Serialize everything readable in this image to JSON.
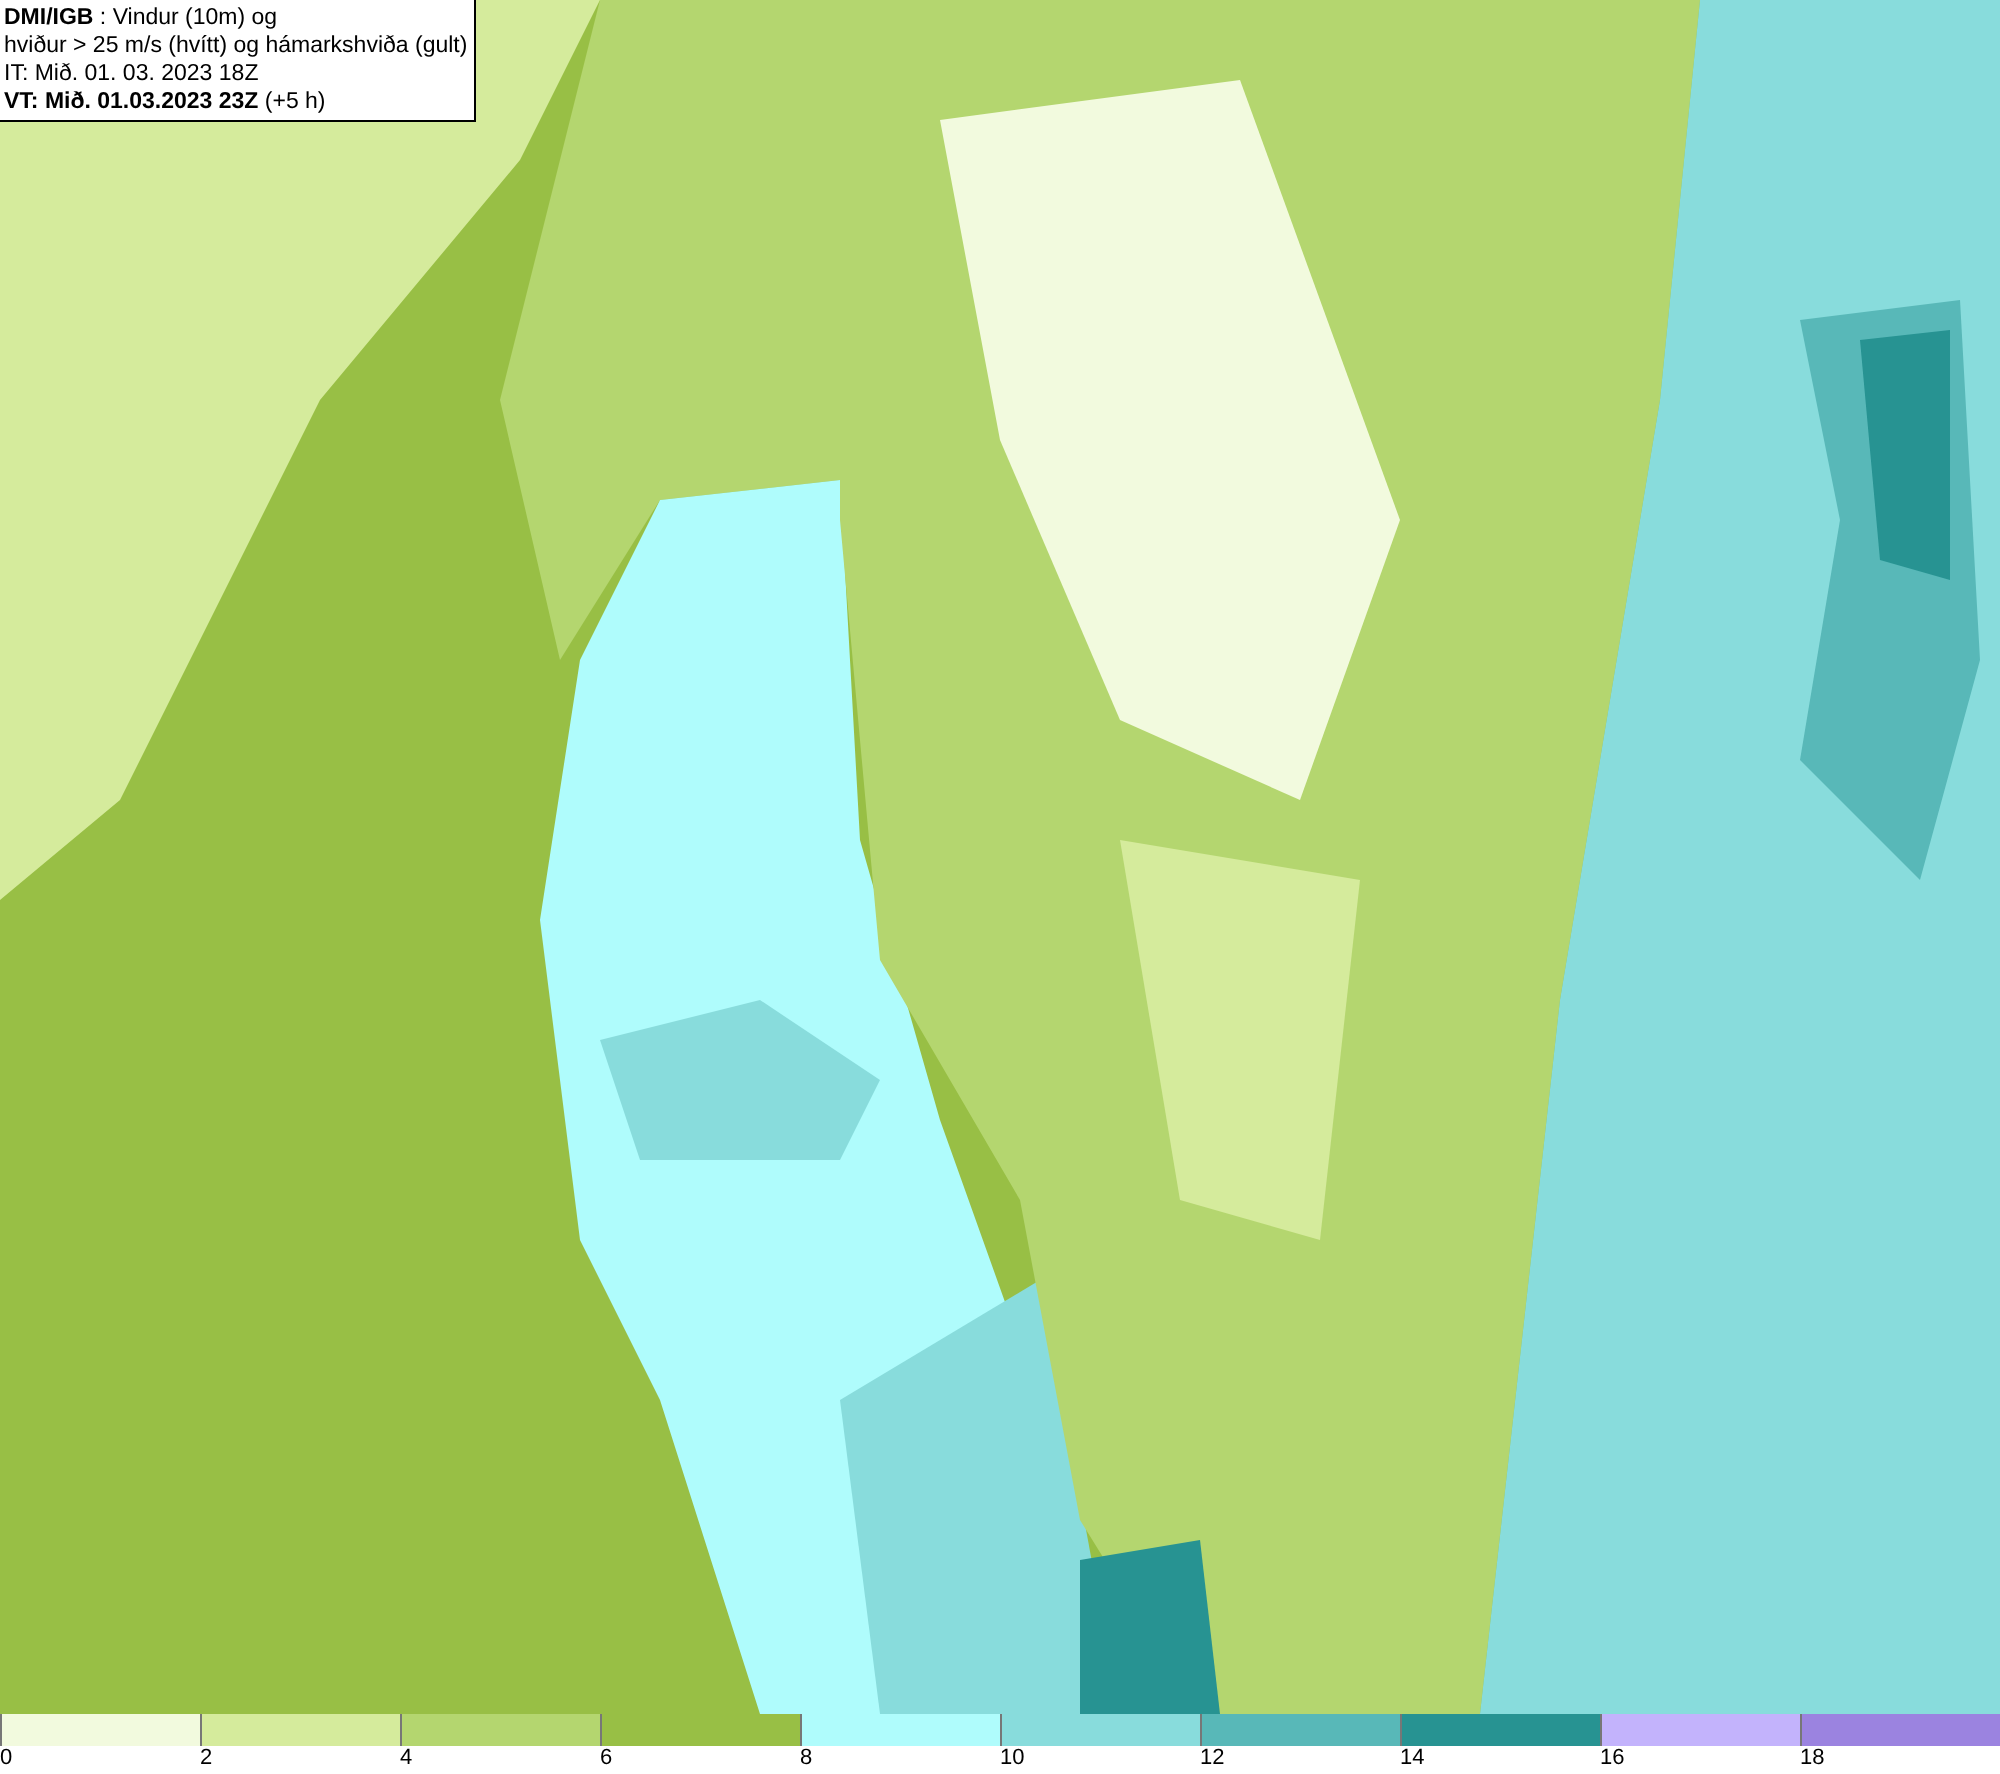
{
  "info_box": {
    "lines": [
      "**DMI/IGB** : Vindur (10m) og",
      "hviður > 25 m/s (hvítt) og hámarkshviða (gult)",
      "IT: Mið. 01. 03. 2023 18Z",
      "**VT: Mið. 01.03.2023 23Z** (+5 h)"
    ]
  },
  "legend": [
    {
      "label": "0",
      "color": "#f2fade"
    },
    {
      "label": "2",
      "color": "#d5eb9c"
    },
    {
      "label": "4",
      "color": "#b4d66f"
    },
    {
      "label": "6",
      "color": "#98bf45"
    },
    {
      "label": "8",
      "color": "#affcfc"
    },
    {
      "label": "10",
      "color": "#88dcdc"
    },
    {
      "label": "12",
      "color": "#58b8b8"
    },
    {
      "label": "14",
      "color": "#279392"
    },
    {
      "label": "16",
      "color": "#c3b3fc"
    },
    {
      "label": "18",
      "color": "#9b83e0"
    }
  ]
}
